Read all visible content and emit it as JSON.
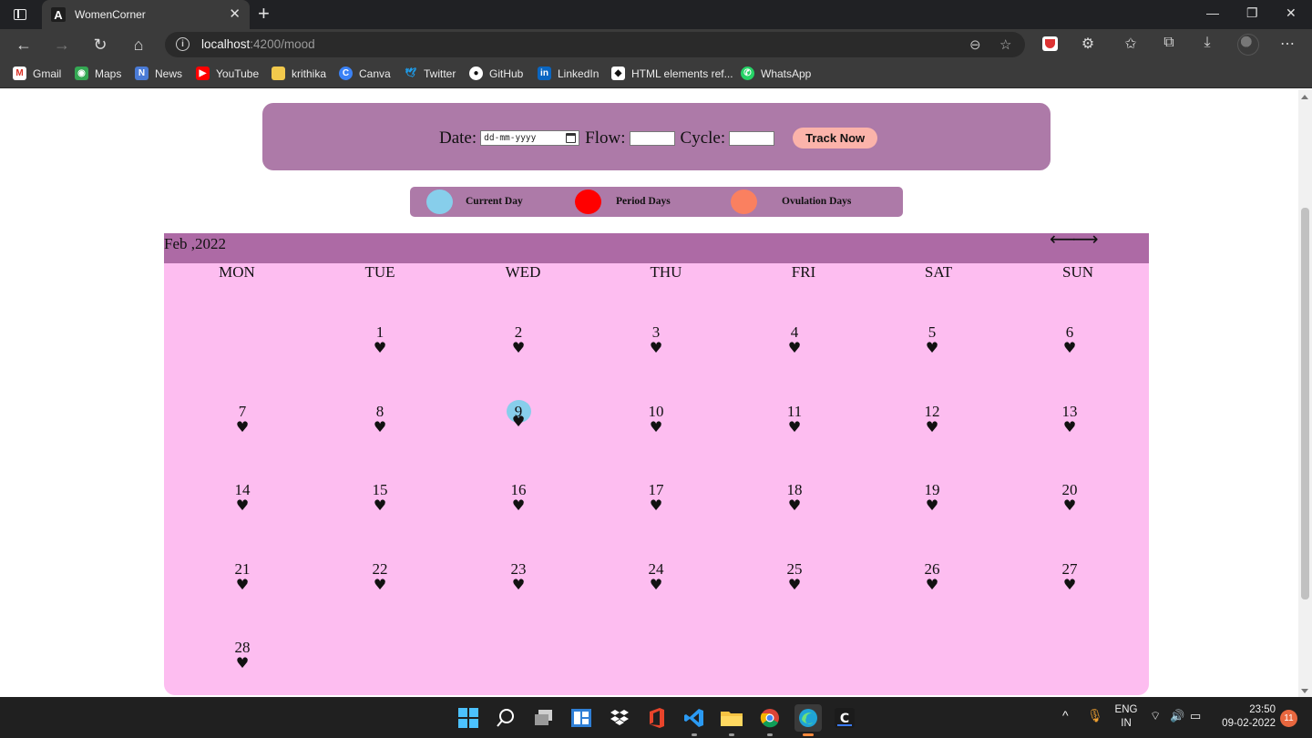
{
  "browser": {
    "tab_title": "WomenCorner",
    "url_host": "localhost",
    "url_rest": ":4200/mood",
    "bookmarks": [
      "Gmail",
      "Maps",
      "News",
      "YouTube",
      "krithika",
      "Canva",
      "Twitter",
      "GitHub",
      "LinkedIn",
      "HTML elements ref...",
      "WhatsApp"
    ]
  },
  "tracker": {
    "date_label": "Date:",
    "date_placeholder": "dd-mm-yyyy",
    "flow_label": "Flow:",
    "cycle_label": "Cycle:",
    "button_label": "Track Now"
  },
  "legend": [
    {
      "label": "Current Day",
      "color": "#87ceeb"
    },
    {
      "label": "Period Days",
      "color": "#ff0000"
    },
    {
      "label": "Ovulation Days",
      "color": "#fa8060"
    }
  ],
  "calendar": {
    "month": "Feb ,2022",
    "prev": "⟵",
    "next": "⟶",
    "weekdays": [
      "MON",
      "TUE",
      "WED",
      "THU",
      "FRI",
      "SAT",
      "SUN"
    ],
    "start_weekday_index": 1,
    "days_in_month": 28,
    "current_day": 9,
    "marker": "♥",
    "colors": {
      "header": "#ad6aa5",
      "body": "#fdbdf0",
      "current": "#87ceeb"
    }
  },
  "taskbar": {
    "lang_top": "ENG",
    "lang_bottom": "IN",
    "time": "23:50",
    "date": "09-02-2022",
    "notifications": "11"
  }
}
